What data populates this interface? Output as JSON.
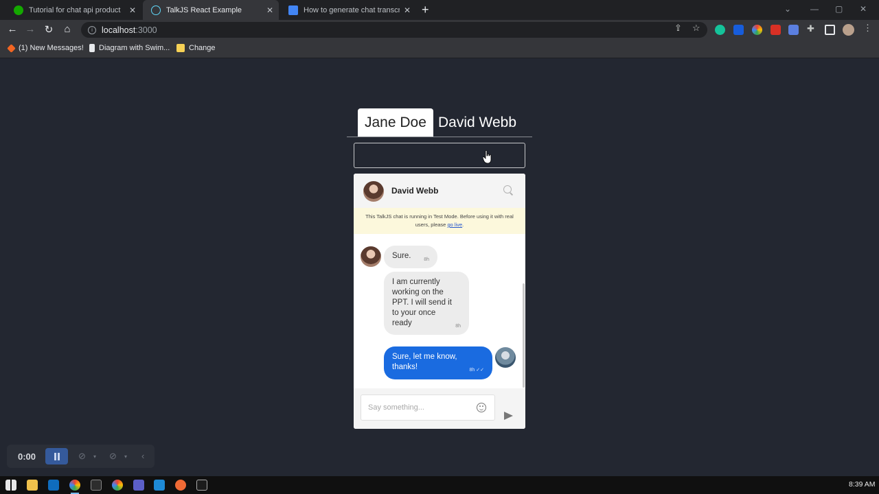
{
  "browser": {
    "tabs": [
      {
        "title": "Tutorial for chat api product",
        "favicon_color": "#14a800"
      },
      {
        "title": "TalkJS React Example",
        "favicon_color": "#61dafb"
      },
      {
        "title": "How to generate chat transcripts",
        "favicon_color": "#4285f4"
      }
    ],
    "active_tab_index": 1,
    "url_host": "localhost",
    "url_port": ":3000",
    "bookmarks": [
      {
        "label": "(1) New Messages!",
        "icon_color": "#f26522"
      },
      {
        "label": "Diagram with Swim...",
        "icon_color": "#e8eaed"
      },
      {
        "label": "Change",
        "icon_color": "#f6d155"
      }
    ]
  },
  "app": {
    "user_tabs": [
      "Jane Doe",
      "David Webb"
    ],
    "active_user_tab": "Jane Doe",
    "top_input_placeholder": ""
  },
  "chat": {
    "header_name": "David Webb",
    "test_mode_text": "This TalkJS chat is running in Test Mode. Before using it with real users, please ",
    "test_mode_link": "go live",
    "test_mode_end": ".",
    "messages": [
      {
        "direction": "in",
        "text": "Sure.",
        "time": "8h"
      },
      {
        "direction": "in",
        "text": "I am currently working on the PPT. I will send it to your once ready",
        "time": "8h"
      },
      {
        "direction": "out",
        "text": "Sure, let me know, thanks!",
        "time": "8h ✓✓"
      }
    ],
    "composer_placeholder": "Say something...",
    "colors": {
      "outgoing": "#1a6be0",
      "incoming": "#ececec",
      "notice": "#fcf8dc"
    }
  },
  "recorder": {
    "time": "0:00"
  },
  "taskbar": {
    "clock": "8:39 AM"
  }
}
